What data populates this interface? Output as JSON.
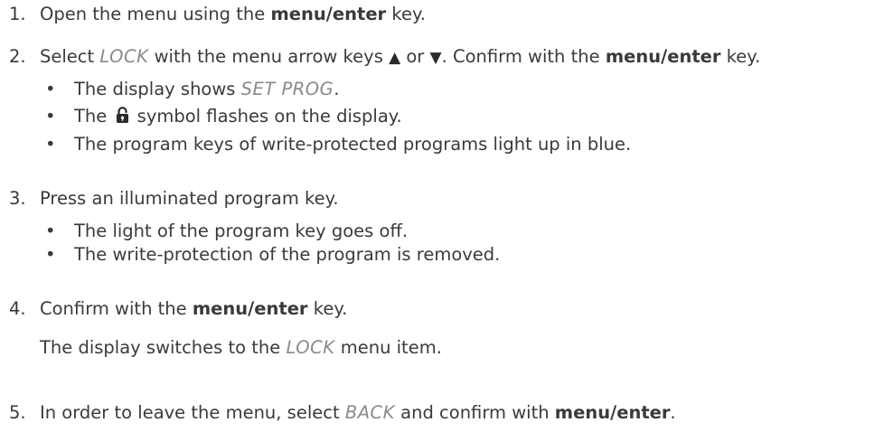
{
  "steps": [
    {
      "num": "1.",
      "parts": {
        "a": "Open the menu using the ",
        "b": "menu/enter",
        "c": " key."
      }
    },
    {
      "num": "2.",
      "parts": {
        "a": "Select ",
        "b": "LOCK",
        "c": " with the menu arrow keys ",
        "up": "▲",
        "d": " or ",
        "down": "▼",
        "e": ". Confirm with the ",
        "f": "menu/enter",
        "g": " key."
      },
      "bullets": [
        {
          "a": "The display shows ",
          "b": "SET PROG",
          "c": "."
        },
        {
          "a": "The ",
          "icon": "unlocked-padlock-icon",
          "c": " symbol flashes on the display."
        },
        {
          "a": "The program keys of write-protected programs light up in blue."
        }
      ]
    },
    {
      "num": "3.",
      "parts": {
        "a": "Press an illuminated program key."
      },
      "bullets": [
        {
          "a": "The light of the program key goes off."
        },
        {
          "a": "The write-protection of the program is removed."
        }
      ]
    },
    {
      "num": "4.",
      "parts": {
        "a": "Confirm with the ",
        "b": "menu/enter",
        "c": " key."
      },
      "result": {
        "a": "The display switches to the ",
        "b": "LOCK",
        "c": " menu item."
      }
    },
    {
      "num": "5.",
      "parts": {
        "a": "In order to leave the menu, select ",
        "b": "BACK",
        "c": " and confirm with ",
        "d": "menu/enter",
        "e": "."
      }
    }
  ],
  "bullet_char": "•"
}
